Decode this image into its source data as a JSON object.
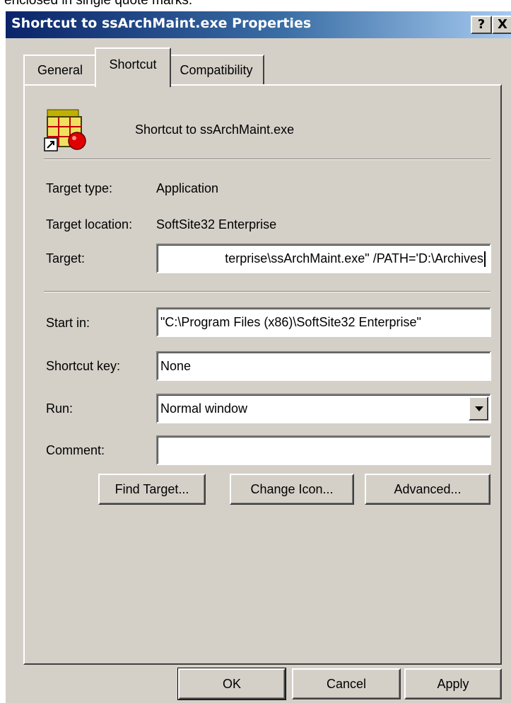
{
  "caption": "enclosed in single quote marks.",
  "window": {
    "title": "Shortcut to ssArchMaint.exe Properties",
    "help_label": "?",
    "close_label": "X"
  },
  "tabs": [
    {
      "label": "General"
    },
    {
      "label": "Shortcut"
    },
    {
      "label": "Compatibility"
    }
  ],
  "app": {
    "name": "Shortcut to ssArchMaint.exe",
    "icon": "application-shortcut-icon"
  },
  "fields": {
    "target_type_label": "Target type:",
    "target_type_value": "Application",
    "target_location_label": "Target location:",
    "target_location_value": "SoftSite32 Enterprise",
    "target_label": "Target:",
    "target_value": "terprise\\ssArchMaint.exe\" /PATH='D:\\Archives",
    "start_in_label": "Start in:",
    "start_in_value": "\"C:\\Program Files (x86)\\SoftSite32 Enterprise\"",
    "shortcut_key_label": "Shortcut key:",
    "shortcut_key_value": "None",
    "run_label": "Run:",
    "run_value": "Normal window",
    "comment_label": "Comment:",
    "comment_value": ""
  },
  "buttons": {
    "find_target": "Find Target...",
    "change_icon": "Change Icon...",
    "advanced": "Advanced...",
    "ok": "OK",
    "cancel": "Cancel",
    "apply": "Apply"
  },
  "colors": {
    "face": "#d4d0c8",
    "title_start": "#0a246a",
    "title_end": "#a6caf0"
  }
}
